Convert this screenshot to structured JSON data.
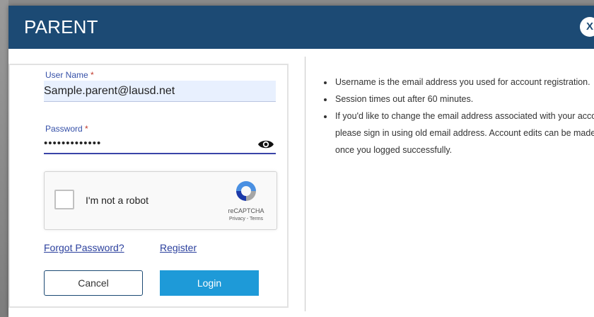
{
  "modal": {
    "title": "PARENT",
    "close_label": "X"
  },
  "login_form": {
    "username_label": "User Name",
    "username_value": "Sample.parent@lausd.net",
    "password_label": "Password",
    "required_marker": "*",
    "password_value": "•••••••••••••",
    "show_password_icon": "eye-icon",
    "captcha": {
      "label": "I'm not a robot",
      "brand": "reCAPTCHA",
      "links": "Privacy - Terms"
    },
    "forgot_password_link": "Forgot Password?",
    "register_link": "Register",
    "cancel_button": "Cancel",
    "login_button": "Login"
  },
  "info": {
    "items": [
      "Username is the email address you used for account registration.",
      "Session times out after 60 minutes.",
      "If you'd like to change the email address associated with your account, please sign in using old email address. Account edits can be made once you logged successfully."
    ]
  },
  "colors": {
    "header": "#1c4a74",
    "login_button": "#1e9ad8",
    "link": "#2a3f9d",
    "input_fill": "#e8f0fe"
  }
}
